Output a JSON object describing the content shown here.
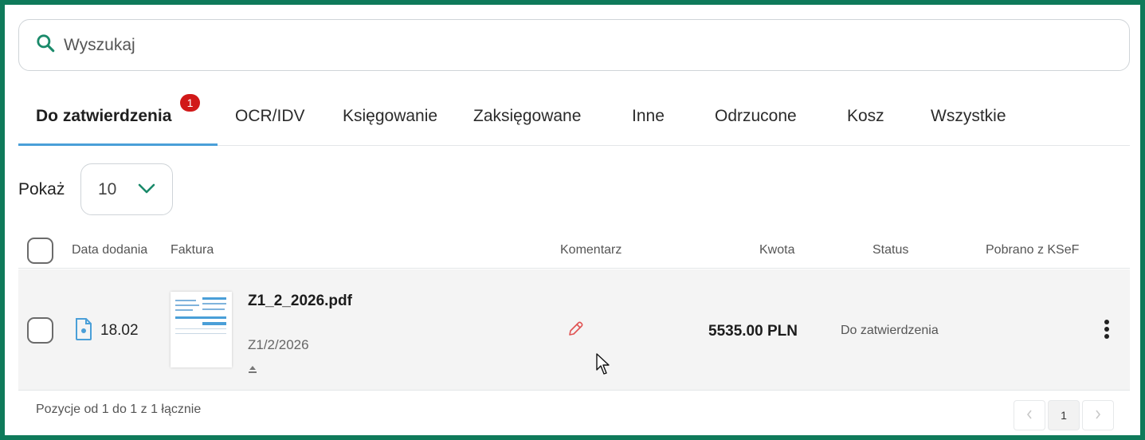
{
  "search": {
    "placeholder": "Wyszukaj",
    "value": ""
  },
  "tabs": [
    {
      "label": "Do zatwierdzenia",
      "active": true,
      "badge": "1"
    },
    {
      "label": "OCR/IDV"
    },
    {
      "label": "Księgowanie"
    },
    {
      "label": "Zaksięgowane"
    },
    {
      "label": "Inne"
    },
    {
      "label": "Odrzucone"
    },
    {
      "label": "Kosz"
    },
    {
      "label": "Wszystkie"
    }
  ],
  "page_size": {
    "label": "Pokaż",
    "value": "10"
  },
  "table": {
    "columns": [
      "Data dodania",
      "Faktura",
      "Komentarz",
      "Kwota",
      "Status",
      "Pobrano z KSeF"
    ],
    "rows": [
      {
        "date": "18.02",
        "file_name": "Z1_2_2026.pdf",
        "invoice_number": "Z1/2/2026",
        "amount": "5535.00 PLN",
        "status": "Do zatwierdzenia",
        "ksef": ""
      }
    ]
  },
  "footer": {
    "summary": "Pozycje od 1 do 1 z 1 łącznie"
  },
  "pagination": {
    "current": "1"
  },
  "colors": {
    "frame": "#0f7a5a",
    "accent": "#1a8a6a",
    "tab_underline": "#4a9fd8",
    "badge": "#d11919",
    "comment_icon": "#e05252"
  },
  "icons": [
    "search-icon",
    "chevron-down-icon",
    "document-icon",
    "pencil-icon",
    "upload-icon",
    "more-vertical-icon",
    "chevron-left-icon",
    "chevron-right-icon",
    "mouse-cursor-icon"
  ]
}
